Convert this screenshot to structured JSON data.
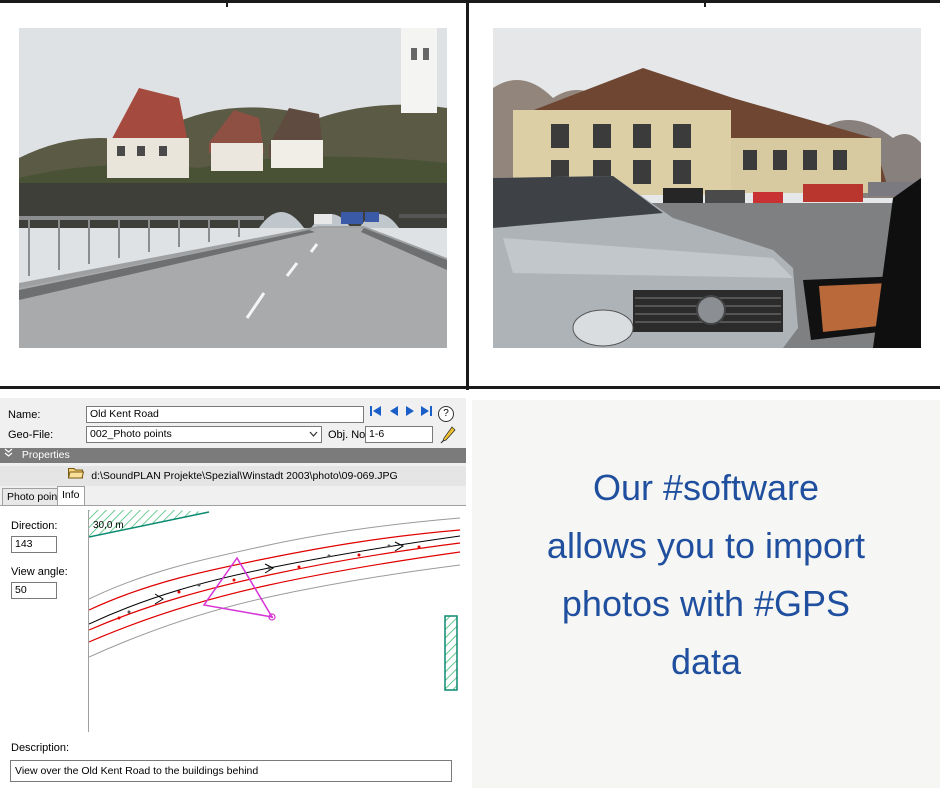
{
  "dialog": {
    "name_label": "Name:",
    "name_value": "Old Kent Road",
    "geofile_label": "Geo-File:",
    "geofile_value": "002_Photo points",
    "objno_label": "Obj. No.",
    "objno_value": "1-6",
    "help_glyph": "?",
    "section_title": "Properties",
    "file_path": "d:\\SoundPLAN Projekte\\Spezial\\Winstadt 2003\\photo\\09-069.JPG",
    "tabs": [
      {
        "label": "Photo point",
        "active": false
      },
      {
        "label": "Info",
        "active": true
      }
    ],
    "direction_label": "Direction:",
    "direction_value": "143",
    "view_angle_label": "View angle:",
    "view_angle_value": "50",
    "scale_label": "30,0 m",
    "description_label": "Description:",
    "description_value": "View over the Old Kent Road to the buildings behind",
    "icons": [
      "first-record-icon",
      "prev-record-icon",
      "next-record-icon",
      "last-record-icon",
      "help-icon",
      "dropdown-arrow-icon",
      "pencil-icon",
      "collapse-icon",
      "folder-icon"
    ],
    "colors": {
      "road_red": "#e00000",
      "road_black": "#000000",
      "view_cone": "#d633d6",
      "hatch_green": "#2fae6a"
    }
  },
  "caption": {
    "lines": [
      "Our #software",
      "allows you to import",
      "photos with #GPS",
      "data"
    ],
    "color": "#1f4f9e"
  }
}
